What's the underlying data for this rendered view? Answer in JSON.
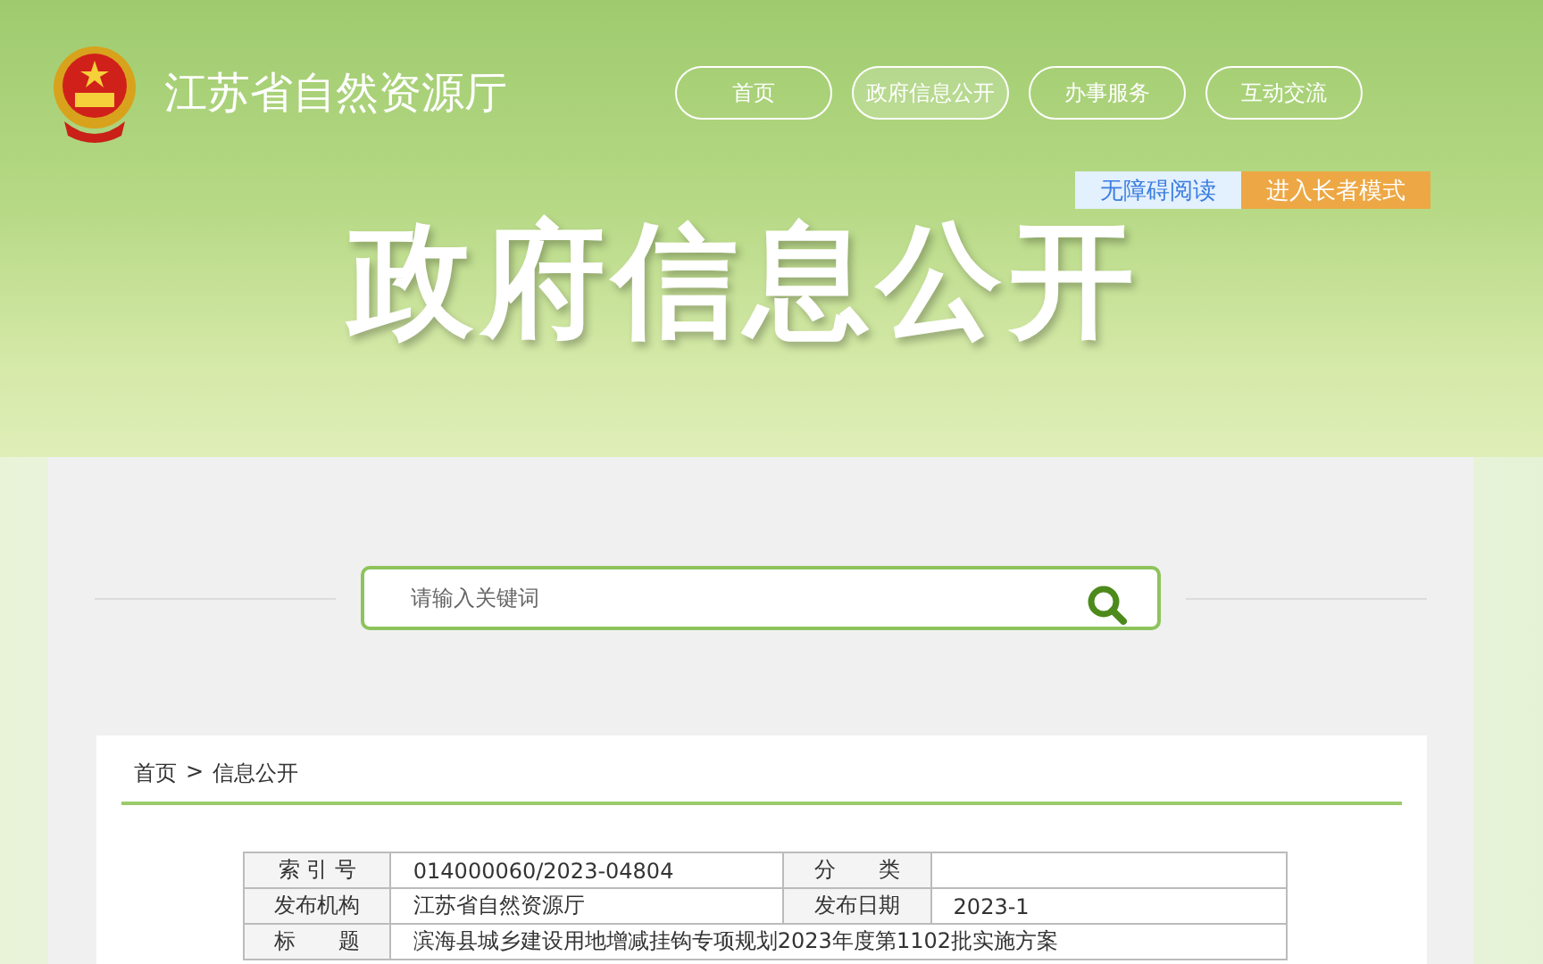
{
  "header": {
    "site_title": "江苏省自然资源厅",
    "nav": [
      {
        "label": "首页",
        "selected": false
      },
      {
        "label": "政府信息公开",
        "selected": true
      },
      {
        "label": "办事服务",
        "selected": false
      },
      {
        "label": "互动交流",
        "selected": false
      }
    ],
    "accessibility_link": "无障碍阅读",
    "elder_mode_link": "进入长者模式",
    "banner_title": "政府信息公开"
  },
  "search": {
    "placeholder": "请输入关键词"
  },
  "breadcrumb": [
    {
      "label": "首页"
    },
    {
      "label": "信息公开"
    }
  ],
  "breadcrumb_separator": ">",
  "info_table": {
    "rows": [
      {
        "label_1": "索 引 号",
        "value_1": "014000060/2023-04804",
        "label_2": "分　　类",
        "value_2": ""
      },
      {
        "label_1": "发布机构",
        "value_1": "江苏省自然资源厅",
        "label_2": "发布日期",
        "value_2": "2023-1"
      },
      {
        "label_1": "标　　题",
        "value_1": "滨海县城乡建设用地增减挂钩专项规划2023年度第1102批实施方案"
      }
    ]
  }
}
